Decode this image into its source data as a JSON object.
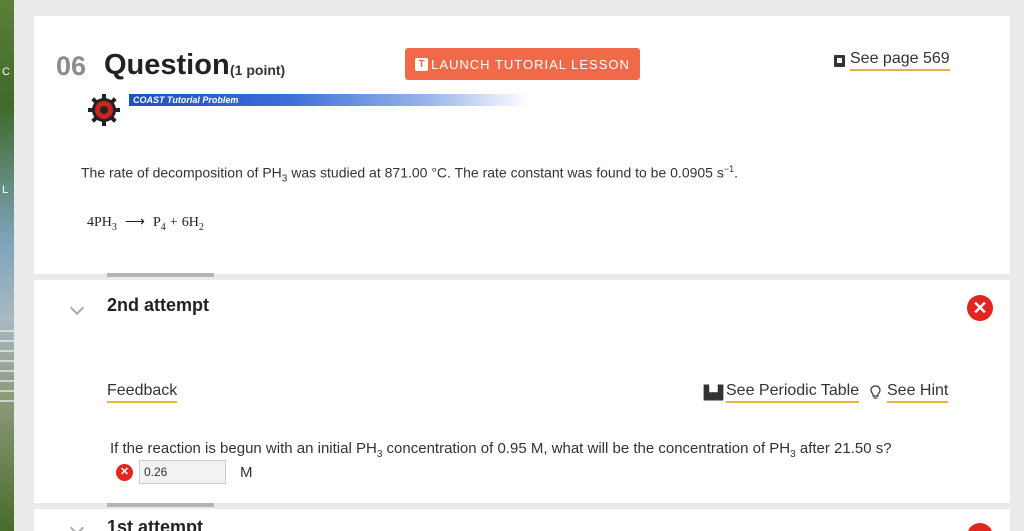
{
  "question": {
    "number": "06",
    "title": "Question",
    "points": "(1 point)",
    "launch_label": "LAUNCH TUTORIAL LESSON",
    "launch_icon_letter": "T",
    "see_page_label": "See page 569",
    "coast_label": "COAST Tutorial Problem",
    "problem_text": {
      "part1": "The rate of decomposition of PH",
      "sub1": "3",
      "part2": " was studied at 871.00 °C. The rate constant was found to be 0.0905  s",
      "sup": "−1",
      "part3": "."
    },
    "equation": {
      "reactant_coef": "4PH",
      "reactant_sub": "3",
      "arrow": "⟶",
      "product1": "P",
      "product1_sub": "4",
      "plus": "+",
      "product2": "6H",
      "product2_sub": "2"
    }
  },
  "attempt": {
    "title": "2nd attempt",
    "status_icon": "x-circle-icon",
    "feedback_label": "Feedback",
    "periodic_label": "See Periodic Table",
    "hint_label": "See Hint",
    "sub_question": {
      "part1": "If the reaction is begun with an initial PH",
      "sub1": "3",
      "part2": " concentration of 0.95 M, what will be the concentration of PH",
      "sub2": "3",
      "part3": " after 21.50  s?"
    },
    "answer_value": "0.26",
    "unit": "M"
  },
  "next_attempt": {
    "title": "1st attempt"
  },
  "colors": {
    "accent_orange": "#f06a49",
    "error_red": "#e2261f",
    "link_underline": "#e5b637",
    "coast_blue": "#1e4fc2"
  }
}
